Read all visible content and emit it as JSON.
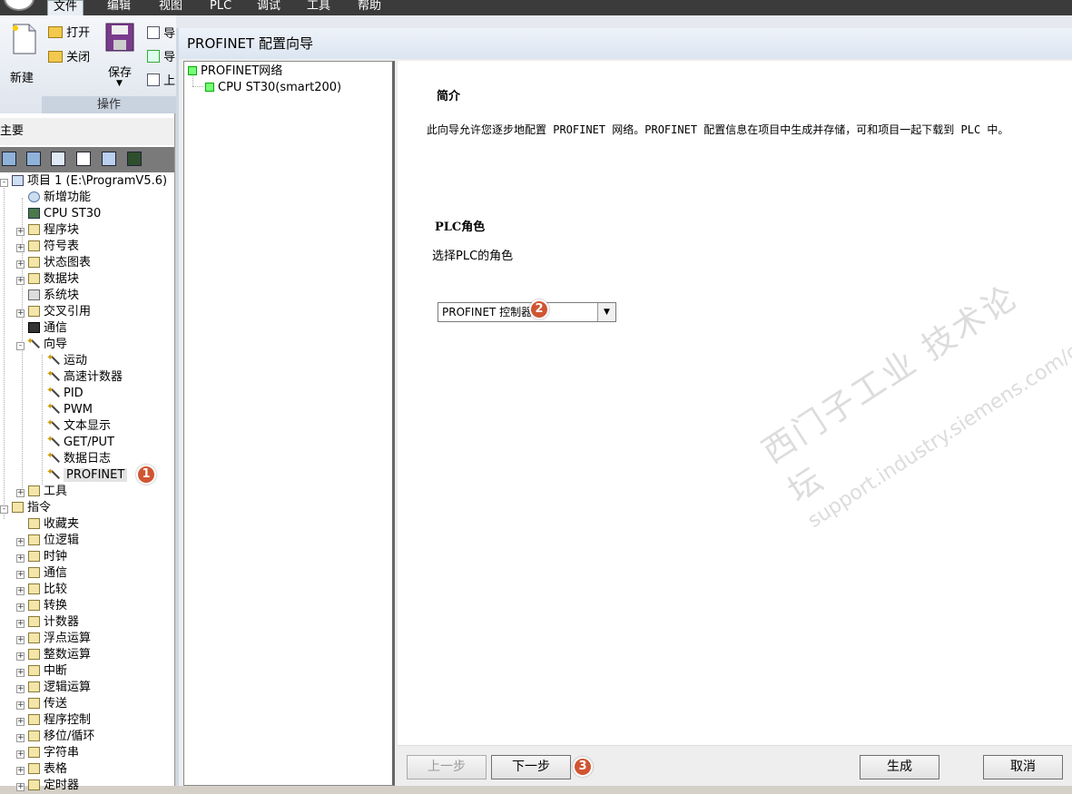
{
  "menubar": {
    "items": [
      "文件",
      "编辑",
      "视图",
      "PLC",
      "调试",
      "工具",
      "帮助"
    ]
  },
  "ribbon": {
    "new_label": "新建",
    "open_label": "打开",
    "close_label": "关闭",
    "save_label": "保存",
    "import_label": "导",
    "export_label": "导",
    "upload_label": "上",
    "group_label": "操作"
  },
  "left_panel": {
    "title": "主要",
    "tree": [
      {
        "label": "项目 1 (E:\\ProgramV5.6)",
        "icon": "project-icon"
      },
      {
        "label": "新增功能",
        "icon": "help-icon"
      },
      {
        "label": "CPU ST30",
        "icon": "cpu-icon"
      },
      {
        "label": "程序块",
        "icon": "folder-icon"
      },
      {
        "label": "符号表",
        "icon": "folder-icon"
      },
      {
        "label": "状态图表",
        "icon": "folder-icon"
      },
      {
        "label": "数据块",
        "icon": "folder-icon"
      },
      {
        "label": "系统块",
        "icon": "document-icon"
      },
      {
        "label": "交叉引用",
        "icon": "folder-icon"
      },
      {
        "label": "通信",
        "icon": "network-icon"
      },
      {
        "label": "向导",
        "icon": "wizard-icon"
      },
      {
        "label": "运动",
        "icon": "wizard-icon"
      },
      {
        "label": "高速计数器",
        "icon": "wizard-icon"
      },
      {
        "label": "PID",
        "icon": "wizard-icon"
      },
      {
        "label": "PWM",
        "icon": "wizard-icon"
      },
      {
        "label": "文本显示",
        "icon": "wizard-icon"
      },
      {
        "label": "GET/PUT",
        "icon": "wizard-icon"
      },
      {
        "label": "数据日志",
        "icon": "wizard-icon"
      },
      {
        "label": "PROFINET",
        "icon": "wizard-icon"
      },
      {
        "label": "工具",
        "icon": "folder-icon"
      },
      {
        "label": "指令",
        "icon": "folder-icon"
      },
      {
        "label": "收藏夹",
        "icon": "folder-icon"
      },
      {
        "label": "位逻辑",
        "icon": "folder-icon"
      },
      {
        "label": "时钟",
        "icon": "folder-icon"
      },
      {
        "label": "通信",
        "icon": "folder-icon"
      },
      {
        "label": "比较",
        "icon": "folder-icon"
      },
      {
        "label": "转换",
        "icon": "folder-icon"
      },
      {
        "label": "计数器",
        "icon": "folder-icon"
      },
      {
        "label": "浮点运算",
        "icon": "folder-icon"
      },
      {
        "label": "整数运算",
        "icon": "folder-icon"
      },
      {
        "label": "中断",
        "icon": "folder-icon"
      },
      {
        "label": "逻辑运算",
        "icon": "folder-icon"
      },
      {
        "label": "传送",
        "icon": "folder-icon"
      },
      {
        "label": "程序控制",
        "icon": "folder-icon"
      },
      {
        "label": "移位/循环",
        "icon": "folder-icon"
      },
      {
        "label": "字符串",
        "icon": "folder-icon"
      },
      {
        "label": "表格",
        "icon": "folder-icon"
      },
      {
        "label": "定时器",
        "icon": "folder-icon"
      }
    ]
  },
  "dialog": {
    "title": "PROFINET 配置向导",
    "nav_tree": {
      "root": "PROFINET网络",
      "child": "CPU ST30(smart200)"
    },
    "intro_heading": "简介",
    "intro_text": "此向导允许您逐步地配置 PROFINET 网络。PROFINET 配置信息在项目中生成并存储，可和项目一起下载到 PLC 中。",
    "role_heading": "PLC角色",
    "role_prompt": "选择PLC的角色",
    "role_selected": "PROFINET 控制器",
    "buttons": {
      "prev": "上一步",
      "next": "下一步",
      "generate": "生成",
      "cancel": "取消"
    }
  },
  "badges": {
    "one": "1",
    "two": "2",
    "three": "3"
  },
  "watermark": {
    "line1": "西门子工业 技术论坛",
    "line2": "support.industry.siemens.com/cs"
  },
  "colors": {
    "badge": "#d05532",
    "menubar": "#3b3b3b",
    "status_square": "#7fff7f"
  }
}
